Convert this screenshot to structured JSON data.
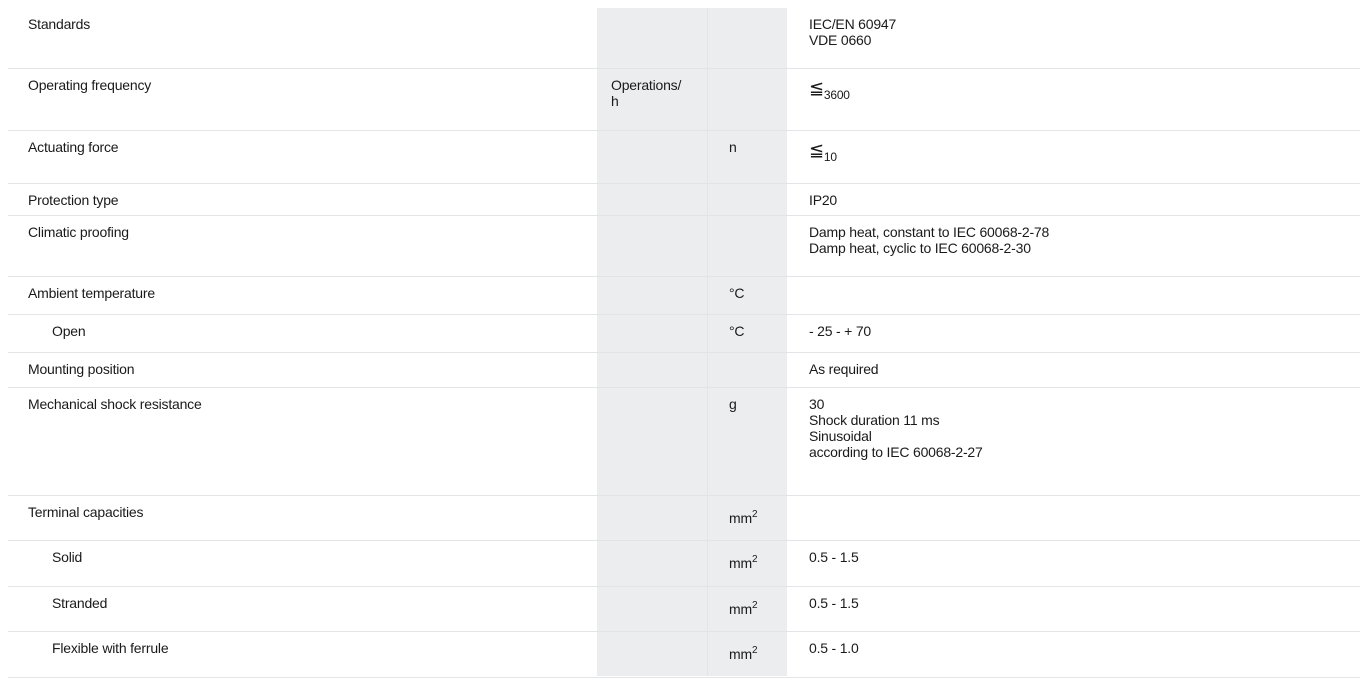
{
  "rows": [
    {
      "label": "Standards",
      "unit1": "",
      "unit2": "",
      "values": [
        "IEC/EN 60947",
        "VDE 0660"
      ],
      "indent": false,
      "h": 60
    },
    {
      "label": "Operating frequency",
      "unit1": [
        "Operations/",
        "h"
      ],
      "unit2": "",
      "sym": "≦",
      "sub": "3600",
      "indent": false,
      "h": 62
    },
    {
      "label": "Actuating force",
      "unit1": "",
      "unit2": "n",
      "sym": "≦",
      "sub": "10",
      "indent": false,
      "h": 53
    },
    {
      "label": "Protection type",
      "unit1": "",
      "unit2": "",
      "values": [
        "IP20"
      ],
      "indent": false,
      "h": 32
    },
    {
      "label": "Climatic proofing",
      "unit1": "",
      "unit2": "",
      "values": [
        "Damp heat, constant to IEC 60068-2-78",
        "Damp heat, cyclic to IEC 60068-2-30"
      ],
      "indent": false,
      "h": 61
    },
    {
      "label": "Ambient temperature",
      "unit1": "",
      "unit2": "°C",
      "values": [],
      "indent": false,
      "h": 38
    },
    {
      "label": "Open",
      "unit1": "",
      "unit2": "°C",
      "values": [
        "- 25 - + 70"
      ],
      "indent": true,
      "h": 38
    },
    {
      "label": "Mounting position",
      "unit1": "",
      "unit2": "",
      "values": [
        "As required"
      ],
      "indent": false,
      "h": 35
    },
    {
      "label": "Mechanical shock resistance",
      "unit1": "",
      "unit2": "g",
      "values": [
        "30",
        "Shock duration 11 ms",
        "Sinusoidal",
        "according to IEC 60068-2-27"
      ],
      "indent": false,
      "h": 108
    },
    {
      "label": "Terminal capacities",
      "unit1": "",
      "unit2": "mm",
      "unit2_sup": "2",
      "values": [],
      "indent": false,
      "h": 45
    },
    {
      "label": "Solid",
      "unit1": "",
      "unit2": "mm",
      "unit2_sup": "2",
      "values": [
        "0.5 - 1.5"
      ],
      "indent": true,
      "h": 46
    },
    {
      "label": "Stranded",
      "unit1": "",
      "unit2": "mm",
      "unit2_sup": "2",
      "values": [
        "0.5 - 1.5"
      ],
      "indent": true,
      "h": 45
    },
    {
      "label": "Flexible with ferrule",
      "unit1": "",
      "unit2": "mm",
      "unit2_sup": "2",
      "values": [
        "0.5 - 1.0"
      ],
      "indent": true,
      "h": 46
    }
  ]
}
